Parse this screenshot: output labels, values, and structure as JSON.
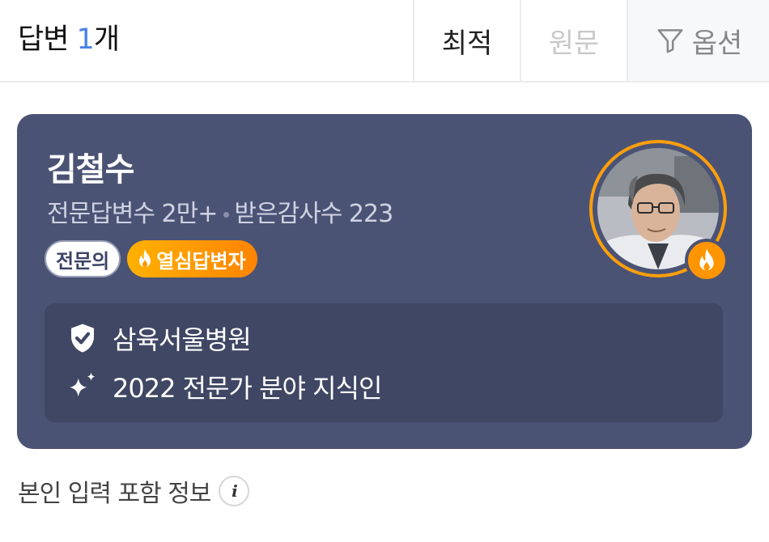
{
  "header": {
    "answer_prefix": "답변 ",
    "answer_count": "1",
    "answer_suffix": "개",
    "tabs": [
      {
        "label": "최적",
        "state": "active"
      },
      {
        "label": "원문",
        "state": "disabled"
      },
      {
        "label": "옵션",
        "icon": "filter-icon"
      }
    ]
  },
  "expert": {
    "name": "김철수",
    "answers_label": "전문답변수",
    "answers_value": "2만+",
    "thanks_label": "받은감사수",
    "thanks_value": "223",
    "badges": {
      "expert": "전문의",
      "hot": "열심답변자",
      "hot_icon": "flame-icon"
    },
    "hospital": "삼육서울병원",
    "hospital_icon": "shield-check-icon",
    "award": "2022 전문가 분야 지식인",
    "award_icon": "sparkle-icon",
    "avatar_ring_color": "#ff9f0a",
    "card_color": "#4b5375"
  },
  "footer": {
    "label": "본인 입력 포함 정보",
    "info_icon": "info-icon",
    "info_glyph": "i"
  }
}
